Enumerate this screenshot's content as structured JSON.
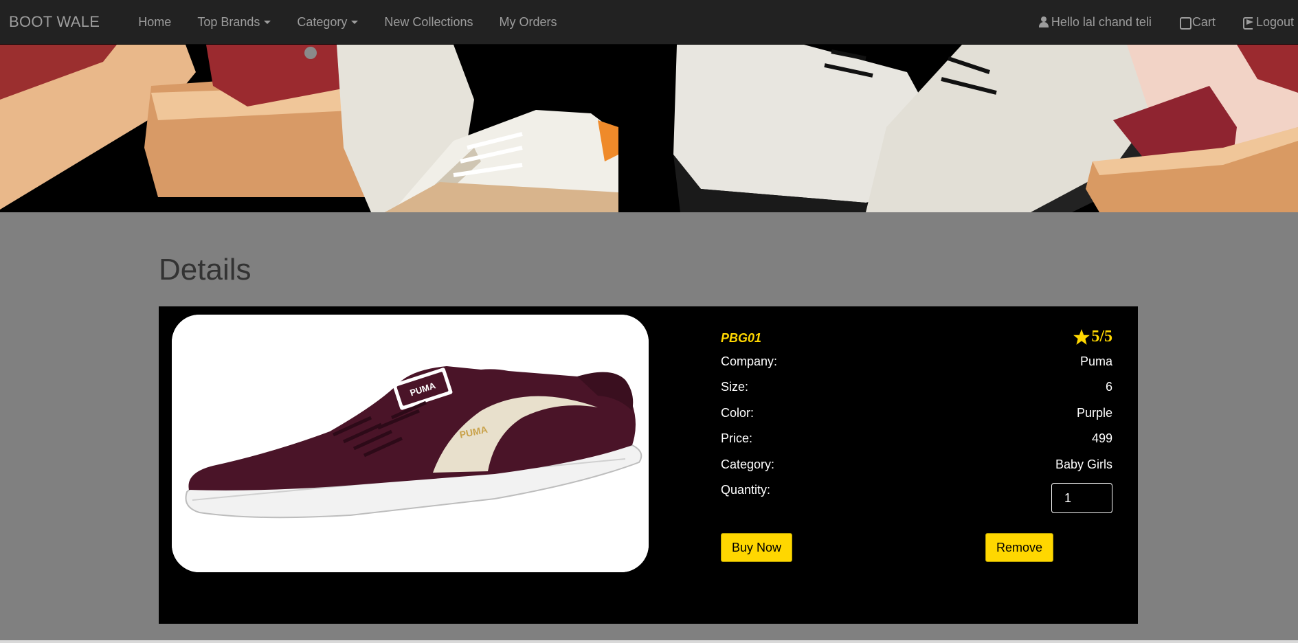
{
  "nav": {
    "brand": "BOOT WALE",
    "items": [
      {
        "label": "Home"
      },
      {
        "label": "Top Brands"
      },
      {
        "label": "Category"
      },
      {
        "label": "New Collections"
      },
      {
        "label": "My Orders"
      }
    ],
    "user_greeting": "Hello lal chand teli",
    "cart": "Cart",
    "logout": "Logout"
  },
  "page": {
    "title": "Details"
  },
  "product": {
    "code": "PBG01",
    "rating": "5/5",
    "fields": [
      {
        "label": "Company:",
        "value": "Puma"
      },
      {
        "label": "Size:",
        "value": "6"
      },
      {
        "label": "Color:",
        "value": "Purple"
      },
      {
        "label": "Price:",
        "value": "499"
      },
      {
        "label": "Category:",
        "value": "Baby Girls"
      }
    ],
    "quantity_label": "Quantity:",
    "quantity_value": "1",
    "image_brand_text": "PUMA",
    "buy_label": "Buy Now",
    "remove_label": "Remove"
  },
  "colors": {
    "navbar": "#222222",
    "page_bg": "#808080",
    "accent": "#ffd700",
    "shoe": "#4a1428"
  }
}
